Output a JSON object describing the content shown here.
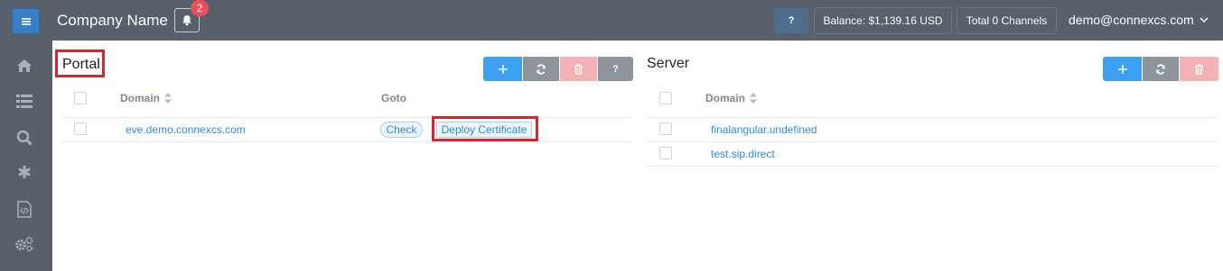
{
  "header": {
    "menu_icon": "hamburger-icon",
    "company_name": "Company Name",
    "notification_icon": "bell-icon",
    "notification_count": "2",
    "help_label": "?",
    "balance_label": "Balance: $1,139.16 USD",
    "channels_label": "Total 0 Channels",
    "user_email": "demo@connexcs.com",
    "user_menu_icon": "chevron-down-icon"
  },
  "sidebar": {
    "items": [
      {
        "icon": "home-icon"
      },
      {
        "icon": "list-icon"
      },
      {
        "icon": "search-icon"
      },
      {
        "icon": "asterisk-icon"
      },
      {
        "icon": "code-file-icon"
      },
      {
        "icon": "gears-icon"
      }
    ]
  },
  "portal": {
    "title": "Portal",
    "toolbar": {
      "add": "+",
      "refresh_icon": "refresh-icon",
      "delete_icon": "trash-icon",
      "help": "?"
    },
    "columns": [
      "Domain",
      "Goto"
    ],
    "rows": [
      {
        "domain": "eve.demo.connexcs.com",
        "check_label": "Check",
        "deploy_label": "Deploy Certificate"
      }
    ]
  },
  "server": {
    "title": "Server",
    "toolbar": {
      "add": "+",
      "refresh_icon": "refresh-icon",
      "delete_icon": "trash-icon"
    },
    "columns": [
      "Domain"
    ],
    "rows": [
      {
        "domain": "finalangular.undefined"
      },
      {
        "domain": "test.sip.direct"
      }
    ]
  },
  "colors": {
    "topbar": "#57606b",
    "accent_blue": "#3b9ff2",
    "link": "#2f8be0",
    "highlight_red": "#e0202a"
  }
}
